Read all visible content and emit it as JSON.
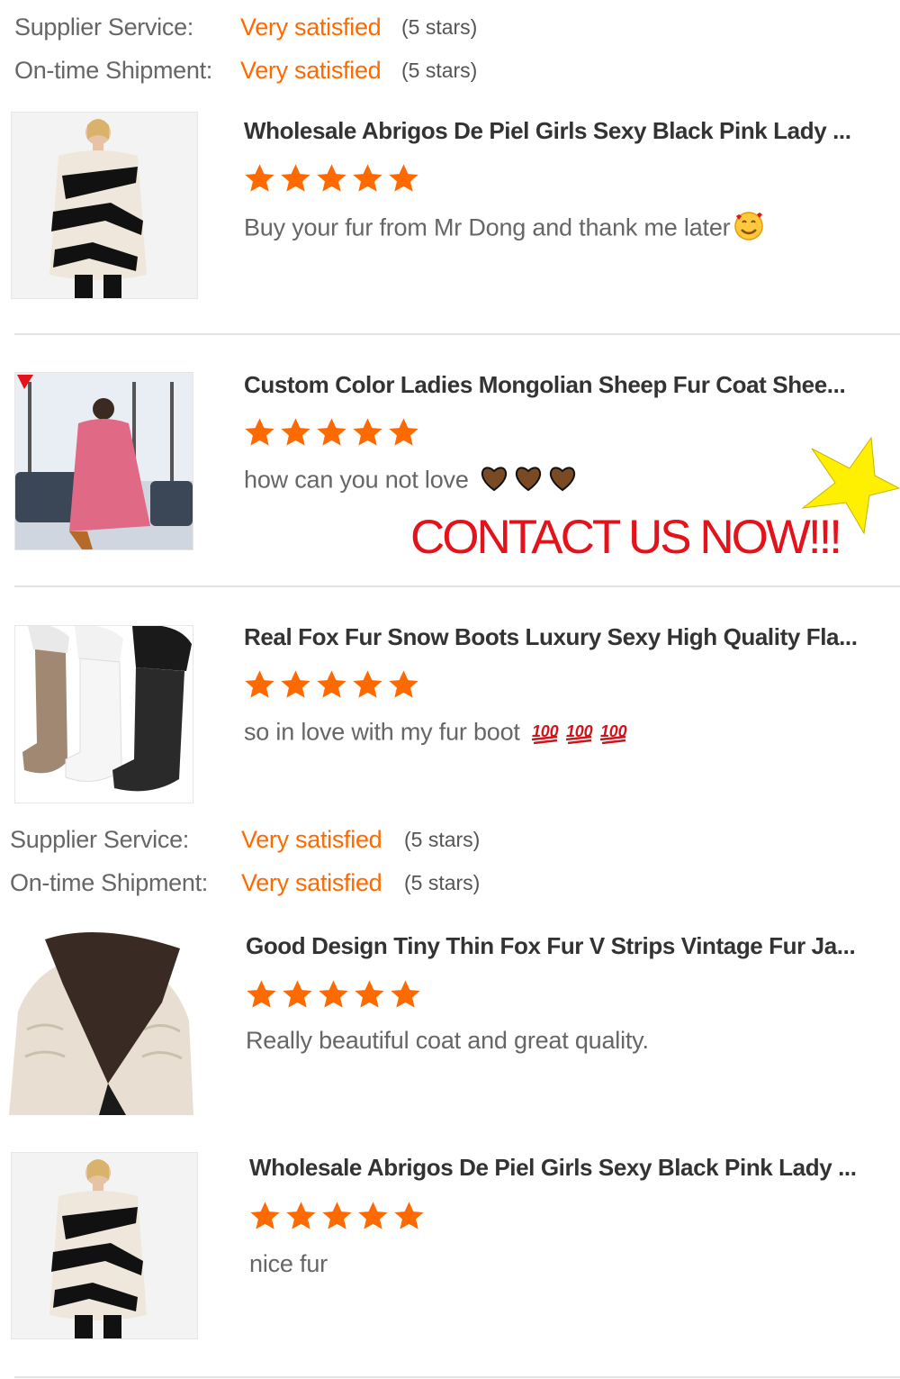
{
  "ratings_top": {
    "supplier_label": "Supplier Service:",
    "supplier_value": "Very satisfied",
    "supplier_stars": "(5 stars)",
    "shipment_label": "On-time Shipment:",
    "shipment_value": "Very satisfied",
    "shipment_stars": "(5 stars)"
  },
  "ratings_mid": {
    "supplier_label": "Supplier Service:",
    "supplier_value": "Very satisfied",
    "supplier_stars": "(5 stars)",
    "shipment_label": "On-time Shipment:",
    "shipment_value": "Very satisfied",
    "shipment_stars": "(5 stars)"
  },
  "reviews": [
    {
      "title": "Wholesale Abrigos De Piel Girls Sexy Black Pink Lady ...",
      "rating": 5,
      "comment": "Buy your fur from Mr Dong and thank me later",
      "emoji": "smiling-face-with-hearts-icon"
    },
    {
      "title": "Custom Color Ladies Mongolian Sheep Fur Coat Shee...",
      "rating": 5,
      "comment": "how can you not love",
      "emoji": "brown-heart-icon x3"
    },
    {
      "title": "Real Fox Fur Snow Boots Luxury Sexy High Quality Fla...",
      "rating": 5,
      "comment": "so in love with my fur boot",
      "emoji": "hundred-points-icon x3"
    },
    {
      "title": "Good Design Tiny Thin Fox Fur V Strips Vintage Fur Ja...",
      "rating": 5,
      "comment": "Really beautiful coat and great quality.",
      "emoji": ""
    },
    {
      "title": "Wholesale Abrigos De Piel Girls Sexy Black Pink Lady ...",
      "rating": 5,
      "comment": "nice fur",
      "emoji": ""
    }
  ],
  "banner": {
    "text": "CONTACT US NOW!!!",
    "color": "#e3121b",
    "burst_color": "#ffef00"
  },
  "colors": {
    "accent": "#ff6a00",
    "star": "#ff6a00",
    "divider": "#e3e3e3"
  }
}
